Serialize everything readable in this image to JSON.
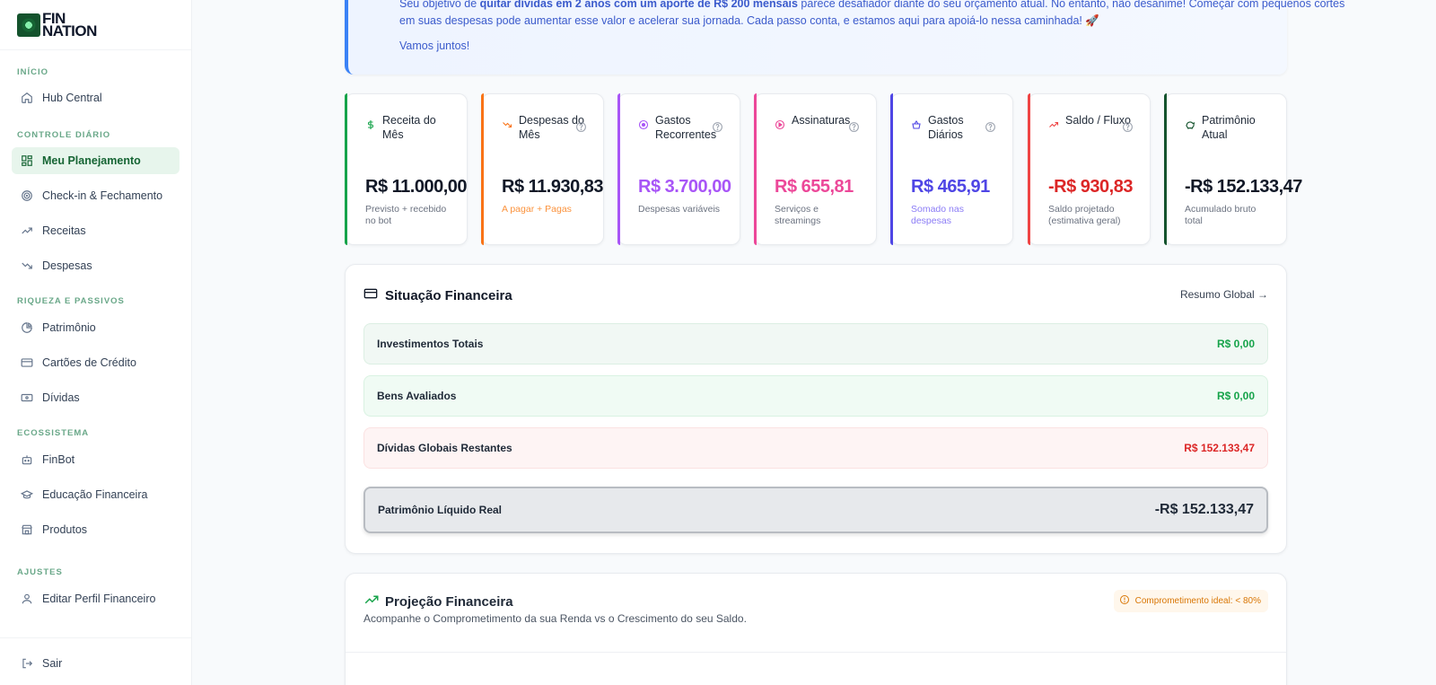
{
  "brand": {
    "line1": "FIN",
    "line2": "NATION"
  },
  "sidebar": {
    "sections": [
      {
        "label": "INÍCIO"
      },
      {
        "label": "CONTROLE DIÁRIO"
      },
      {
        "label": "RIQUEZA E PASSIVOS"
      },
      {
        "label": "ECOSSISTEMA"
      },
      {
        "label": "AJUSTES"
      }
    ],
    "items": [
      {
        "label": "Hub Central",
        "icon": "home-icon"
      },
      {
        "label": "Meu Planejamento",
        "icon": "grid-icon",
        "active": true
      },
      {
        "label": "Check-in & Fechamento",
        "icon": "target-icon"
      },
      {
        "label": "Receitas",
        "icon": "trending-up-icon"
      },
      {
        "label": "Despesas",
        "icon": "trending-down-icon"
      },
      {
        "label": "Patrimônio",
        "icon": "pie-chart-icon"
      },
      {
        "label": "Cartões de Crédito",
        "icon": "credit-card-icon"
      },
      {
        "label": "Dívidas",
        "icon": "banknote-icon"
      },
      {
        "label": "FinBot",
        "icon": "bot-icon"
      },
      {
        "label": "Educação Financeira",
        "icon": "graduation-cap-icon"
      },
      {
        "label": "Produtos",
        "icon": "store-icon"
      },
      {
        "label": "Editar Perfil Financeiro",
        "icon": "user-icon"
      }
    ],
    "logout": {
      "label": "Sair",
      "icon": "logout-icon"
    }
  },
  "banner": {
    "line1_a": "Seu objetivo de ",
    "line1_b": "quitar dívidas em 2 anos com um aporte de R$ 200 mensais",
    "line1_c": " parece desafiador diante do seu orçamento atual. No entanto, não desanime! Começar com pequenos cortes",
    "line2": "em suas despesas pode aumentar esse valor e acelerar sua jornada. Cada passo conta, e estamos aqui para apoiá-lo nessa caminhada! 🚀",
    "cta": "Vamos juntos!"
  },
  "cards": [
    {
      "title": "Receita do Mês",
      "value": "R$ 11.000,00",
      "sub": "Previsto + recebido no bot",
      "accent": "#16a34a",
      "value_color": "#111827",
      "sub_color": "#6b7280",
      "icon": "dollar-icon",
      "help": false
    },
    {
      "title": "Despesas do Mês",
      "value": "R$ 11.930,83",
      "sub": "A pagar + Pagas",
      "accent": "#f97316",
      "value_color": "#111827",
      "sub_color": "#fb923c",
      "icon": "trending-down-icon",
      "help": true
    },
    {
      "title": "Gastos Recorrentes",
      "value": "R$ 3.700,00",
      "sub": "Despesas variáveis",
      "accent": "#a855f7",
      "value_color": "#a855f7",
      "sub_color": "#6b7280",
      "icon": "circle-dot-icon",
      "help": true
    },
    {
      "title": "Assinaturas",
      "value": "R$ 655,81",
      "sub": "Serviços e streamings",
      "accent": "#ec4899",
      "value_color": "#ec4899",
      "sub_color": "#6b7280",
      "icon": "play-circle-icon",
      "help": true
    },
    {
      "title": "Gastos Diários",
      "value": "R$ 465,91",
      "sub": "Somado nas despesas",
      "accent": "#4f46e5",
      "value_color": "#4f46e5",
      "sub_color": "#8b7cf6",
      "icon": "basket-icon",
      "help": true
    },
    {
      "title": "Saldo / Fluxo",
      "value": "-R$ 930,83",
      "sub": "Saldo projetado (estimativa geral)",
      "accent": "#ef4444",
      "value_color": "#dc2626",
      "sub_color": "#6b7280",
      "icon": "trending-up-icon",
      "help": true
    },
    {
      "title": "Patrimônio Atual",
      "value": "-R$ 152.133,47",
      "sub": "Acumulado bruto total",
      "accent": "#14532d",
      "value_color": "#111827",
      "sub_color": "#6b7280",
      "icon": "piggy-bank-icon",
      "help": false
    }
  ],
  "situacao": {
    "title": "Situação Financeira",
    "link": "Resumo Global →",
    "rows": [
      {
        "label": "Investimentos Totais",
        "value": "R$ 0,00",
        "bg": "#f1f8f4",
        "border": "#dcefe3",
        "color": "#16a34a"
      },
      {
        "label": "Bens Avaliados",
        "value": "R$ 0,00",
        "bg": "#f0fbf4",
        "border": "#d9f2e2",
        "color": "#16a34a"
      },
      {
        "label": "Dívidas Globais Restantes",
        "value": "R$ 152.133,47",
        "bg": "#fef4f4",
        "border": "#fbe2e2",
        "color": "#dc2626"
      }
    ],
    "net": {
      "label": "Patrimônio Líquido Real",
      "value": "-R$ 152.133,47"
    }
  },
  "projecao": {
    "title": "Projeção Financeira",
    "subtitle": "Acompanhe o Comprometimento da sua Renda vs o Crescimento do seu Saldo.",
    "badge": "Comprometimento ideal: < 80%"
  }
}
